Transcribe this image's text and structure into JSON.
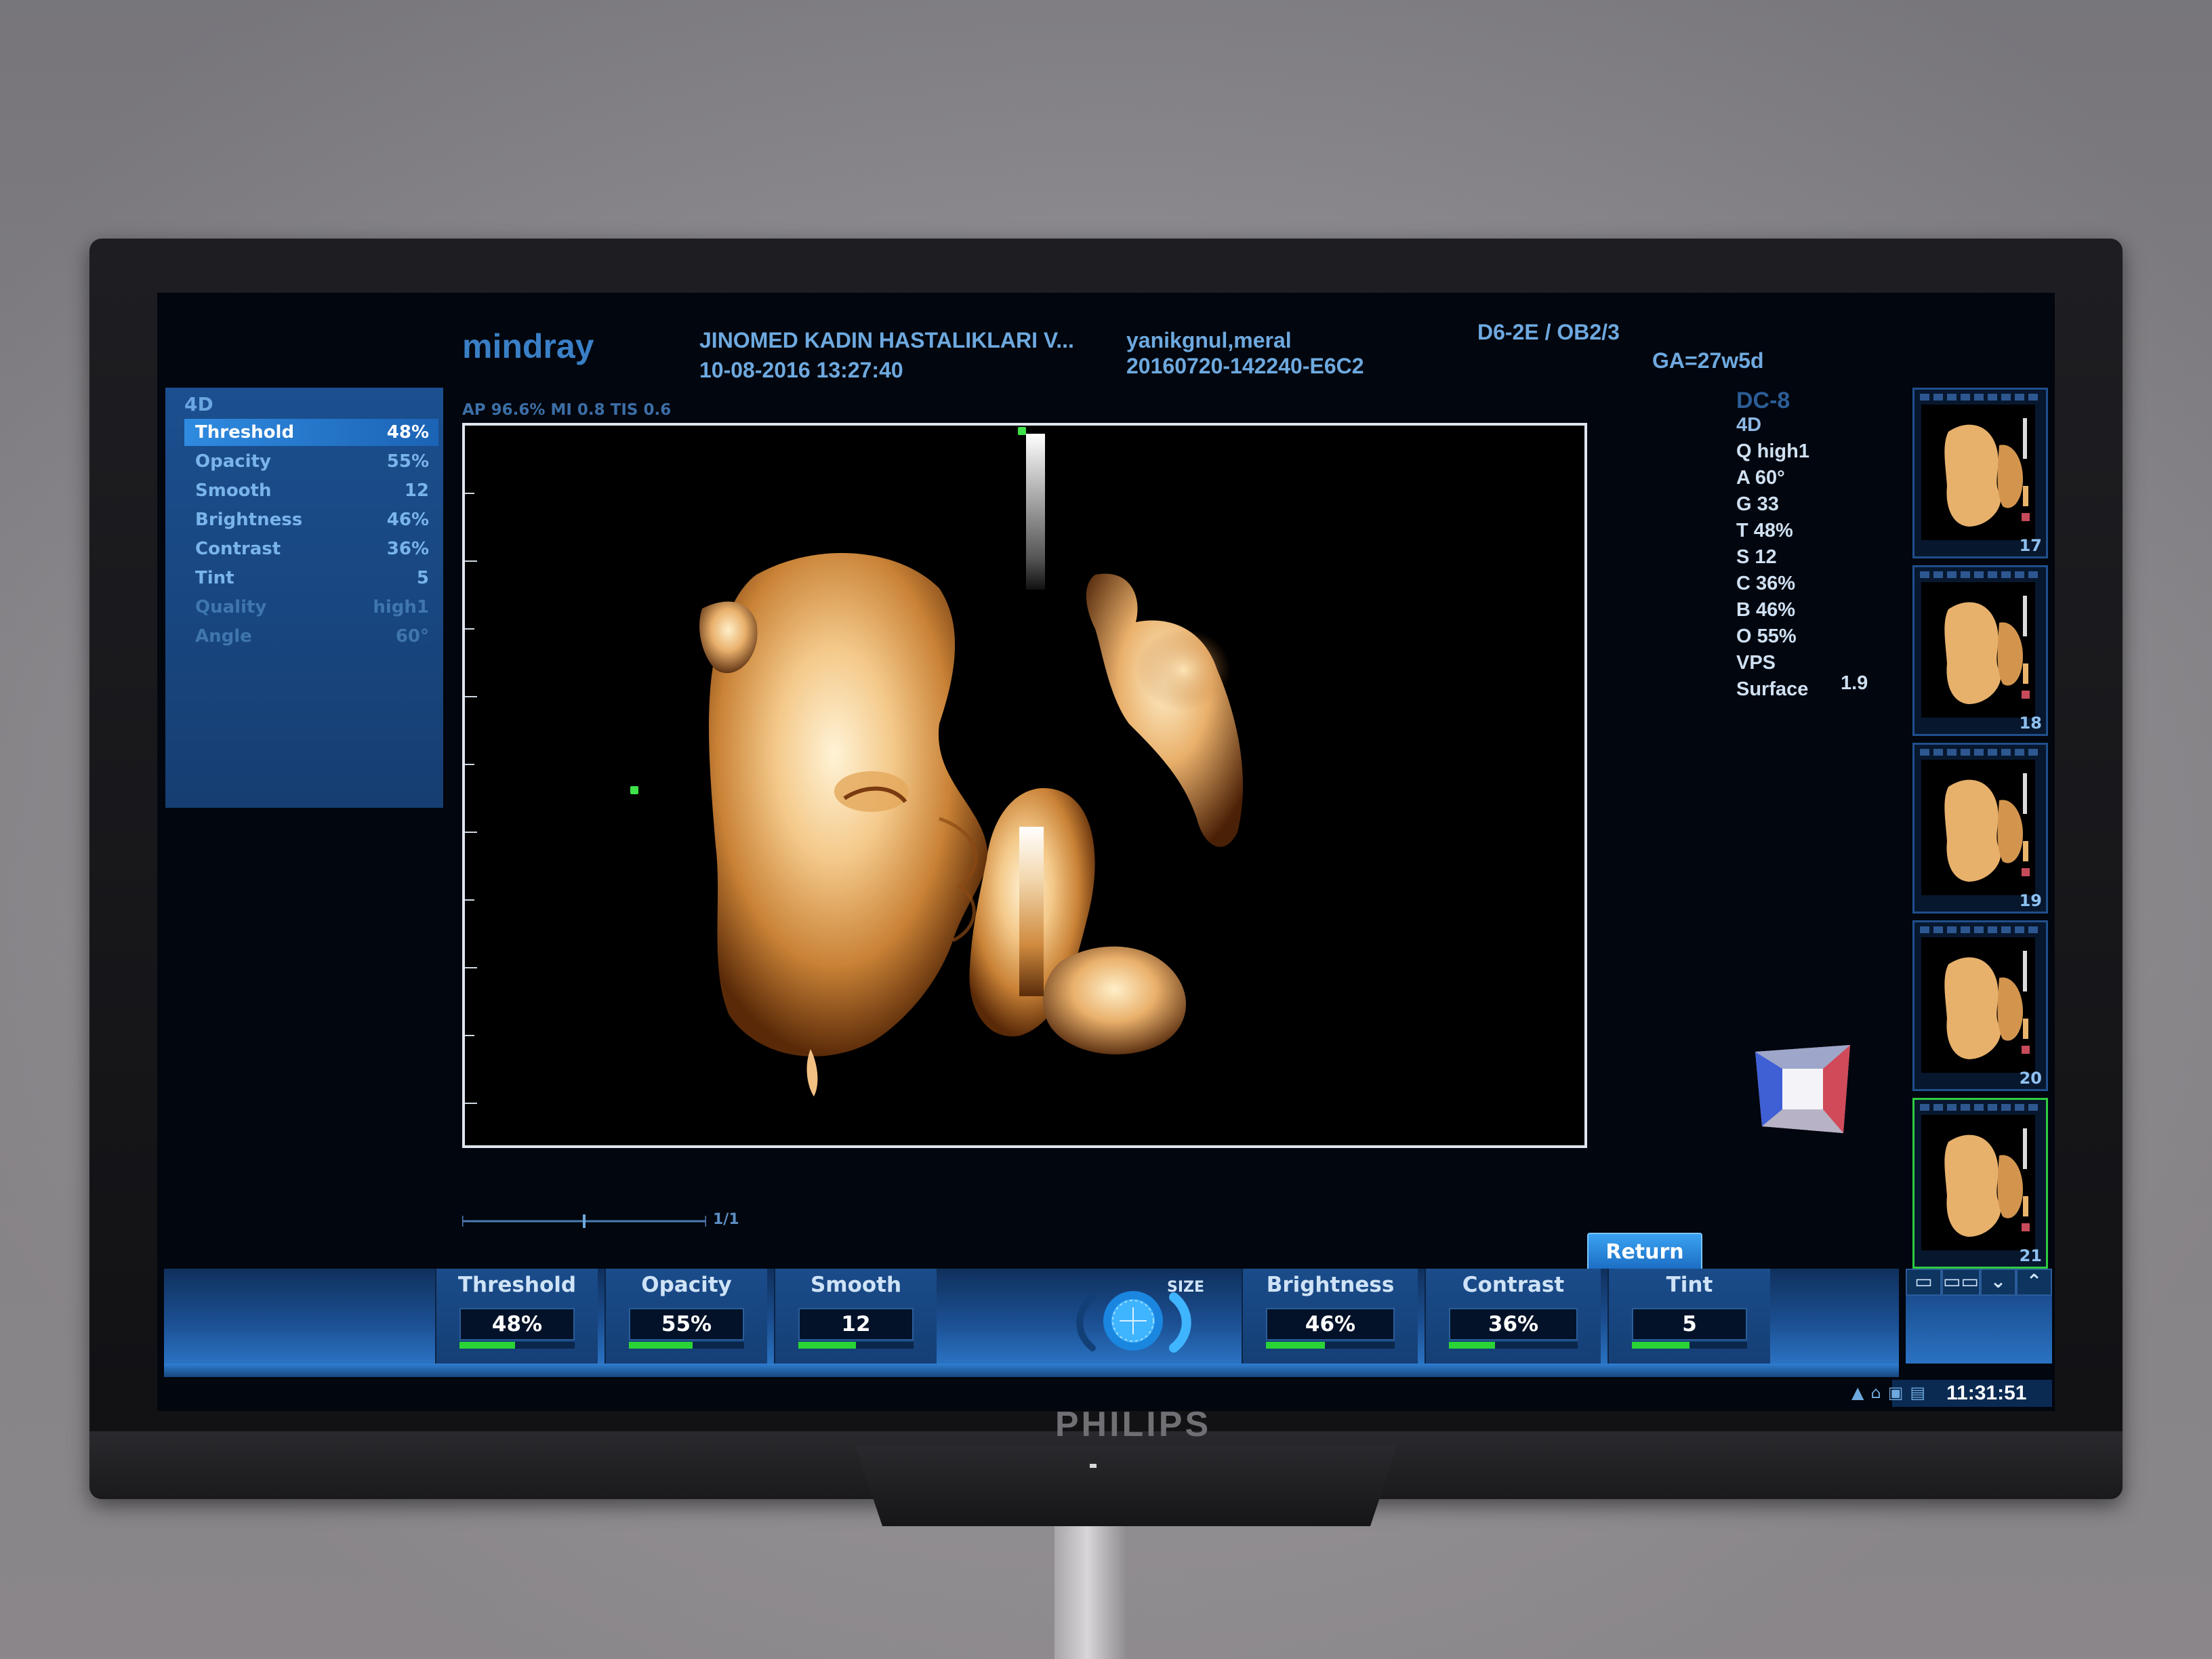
{
  "monitor": {
    "brand": "PHILIPS"
  },
  "header": {
    "logo": "mindray",
    "hospital": "JINOMED KADIN HASTALIKLARI V...",
    "datetime": "10-08-2016  13:27:40",
    "patient_name": "yanikgnul,meral",
    "exam_id": "20160720-142240-E6C2",
    "probe_preset": "D6-2E / OB2/3",
    "gestational_age": "GA=27w5d"
  },
  "left_panel": {
    "title": "4D",
    "params": [
      {
        "label": "Threshold",
        "value": "48%",
        "state": "selected"
      },
      {
        "label": "Opacity",
        "value": "55%",
        "state": "normal"
      },
      {
        "label": "Smooth",
        "value": "12",
        "state": "normal"
      },
      {
        "label": "Brightness",
        "value": "46%",
        "state": "normal"
      },
      {
        "label": "Contrast",
        "value": "36%",
        "state": "normal"
      },
      {
        "label": "Tint",
        "value": "5",
        "state": "normal"
      },
      {
        "label": "Quality",
        "value": "high1",
        "state": "dim"
      },
      {
        "label": "Angle",
        "value": "60°",
        "state": "dim"
      }
    ]
  },
  "image": {
    "acoustic_info": "AP 96.6%  MI 0.8  TIS 0.6",
    "scale_label": "1/1"
  },
  "info_column": {
    "probe": "DC-8",
    "mode": "4D",
    "lines": [
      "Q high1",
      "A 60°",
      "G 33",
      "T 48%",
      "S 12",
      "C 36%",
      "B 46%",
      "O 55%",
      "VPS",
      "Surface"
    ],
    "vps_value": "1.9"
  },
  "thumbnails": [
    {
      "number": "17",
      "active": false
    },
    {
      "number": "18",
      "active": false
    },
    {
      "number": "19",
      "active": false
    },
    {
      "number": "20",
      "active": false
    },
    {
      "number": "21",
      "active": true
    }
  ],
  "return_button": "Return",
  "controls": [
    {
      "label": "Threshold",
      "value": "48%",
      "level": 0.48
    },
    {
      "label": "Opacity",
      "value": "55%",
      "level": 0.55
    },
    {
      "label": "Smooth",
      "value": "12",
      "level": 0.5
    },
    {
      "label": "Brightness",
      "value": "46%",
      "level": 0.46
    },
    {
      "label": "Contrast",
      "value": "36%",
      "level": 0.36
    },
    {
      "label": "Tint",
      "value": "5",
      "level": 0.5
    }
  ],
  "trackball": {
    "label": "SIZE"
  },
  "layout_buttons": [
    "▭",
    "▭▭",
    "⌄",
    "⌃"
  ],
  "status": {
    "clock": "11:31:51"
  },
  "colors": {
    "accent": "#3a7fc6",
    "panel": "#1b4f8f",
    "fill": "#2ad436",
    "frame": "#dfe6ee"
  }
}
